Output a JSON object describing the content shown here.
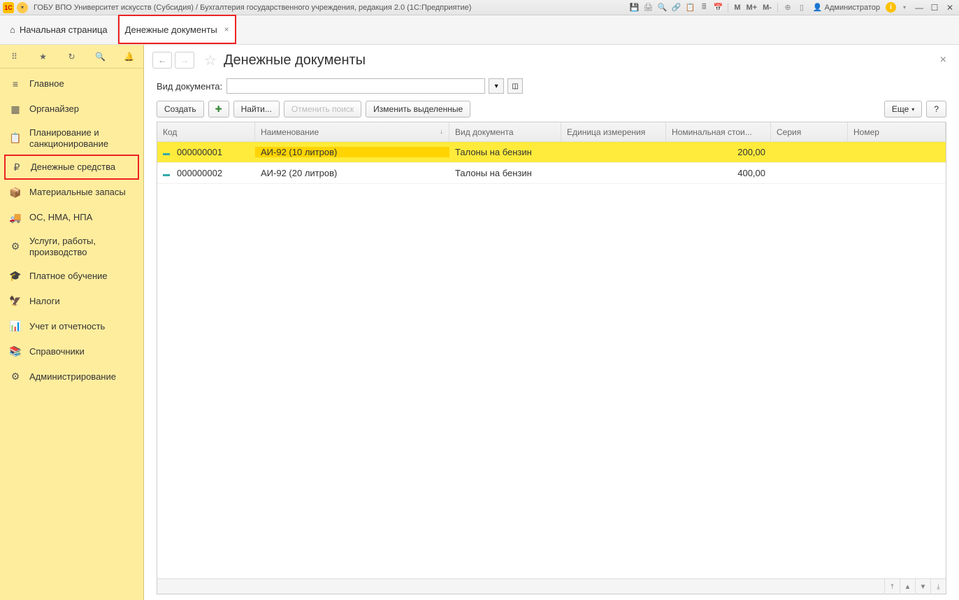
{
  "titleBar": {
    "logo": "1C",
    "title": "ГОБУ ВПО Университет искусств (Субсидия) / Бухгалтерия государственного учреждения, редакция 2.0  (1С:Предприятие)",
    "user": "Администратор",
    "m": "M",
    "mp": "M+",
    "mm": "M-"
  },
  "tabs": {
    "home": "Начальная страница",
    "active": "Денежные документы"
  },
  "sidebar": {
    "items": [
      {
        "icon": "≡",
        "label": "Главное"
      },
      {
        "icon": "▦",
        "label": "Органайзер"
      },
      {
        "icon": "📋",
        "label": "Планирование и санкционирование"
      },
      {
        "icon": "₽",
        "label": "Денежные средства"
      },
      {
        "icon": "📦",
        "label": "Материальные запасы"
      },
      {
        "icon": "🚚",
        "label": "ОС, НМА, НПА"
      },
      {
        "icon": "⚙",
        "label": "Услуги, работы, производство"
      },
      {
        "icon": "🎓",
        "label": "Платное обучение"
      },
      {
        "icon": "🦅",
        "label": "Налоги"
      },
      {
        "icon": "📊",
        "label": "Учет и отчетность"
      },
      {
        "icon": "📚",
        "label": "Справочники"
      },
      {
        "icon": "⚙",
        "label": "Администрирование"
      }
    ]
  },
  "page": {
    "title": "Денежные документы",
    "filterLabel": "Вид документа:"
  },
  "toolbar": {
    "create": "Создать",
    "find": "Найти...",
    "cancelSearch": "Отменить поиск",
    "editSelected": "Изменить выделенные",
    "more": "Еще",
    "help": "?"
  },
  "table": {
    "headers": {
      "code": "Код",
      "name": "Наименование",
      "type": "Вид документа",
      "unit": "Единица измерения",
      "nominal": "Номинальная стои...",
      "series": "Серия",
      "number": "Номер"
    },
    "rows": [
      {
        "code": "000000001",
        "name": "АИ-92 (10 литров)",
        "type": "Талоны на бензин",
        "unit": "",
        "nominal": "200,00",
        "series": "",
        "number": ""
      },
      {
        "code": "000000002",
        "name": "АИ-92 (20 литров)",
        "type": "Талоны на бензин",
        "unit": "",
        "nominal": "400,00",
        "series": "",
        "number": ""
      }
    ]
  }
}
